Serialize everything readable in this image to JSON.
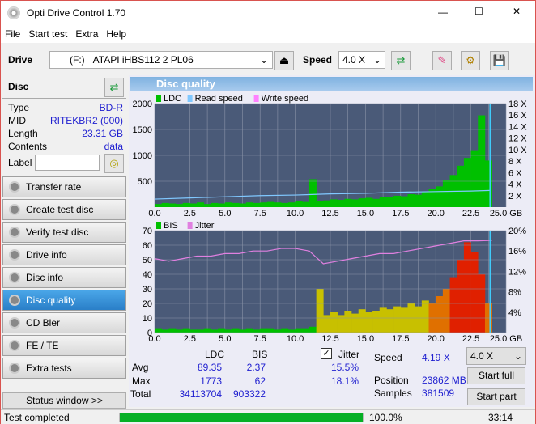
{
  "window": {
    "title": "Opti Drive Control 1.70",
    "minimize": "—",
    "maximize": "☐",
    "close": "✕"
  },
  "menu": [
    "File",
    "Start test",
    "Extra",
    "Help"
  ],
  "toolbar": {
    "drive_label": "Drive",
    "drive_letter": "(F:)",
    "drive_name": "ATAPI iHBS112  2 PL06",
    "speed_label": "Speed",
    "speed_value": "4.0 X"
  },
  "disc": {
    "title": "Disc",
    "type_label": "Type",
    "type": "BD-R",
    "mid_label": "MID",
    "mid": "RITEKBR2 (000)",
    "length_label": "Length",
    "length": "23.31 GB",
    "contents_label": "Contents",
    "contents": "data",
    "label_label": "Label",
    "label_value": ""
  },
  "sidebar": {
    "items": [
      "Transfer rate",
      "Create test disc",
      "Verify test disc",
      "Drive info",
      "Disc info",
      "Disc quality",
      "CD Bler",
      "FE / TE",
      "Extra tests"
    ],
    "selected": "Disc quality",
    "status_window": "Status window >>"
  },
  "panel_title": "Disc quality",
  "colors": {
    "ldc": "#00c000",
    "read_speed": "#80c8ff",
    "write_speed": "#ff80ff",
    "bis": "#00c000",
    "jitter": "#e080e0",
    "accent": "#2a7fc8",
    "progress": "#06b025"
  },
  "chart_data": [
    {
      "type": "bar",
      "legend": [
        "LDC",
        "Read speed",
        "Write speed"
      ],
      "x_ticks": [
        "0.0",
        "2.5",
        "5.0",
        "7.5",
        "10.0",
        "12.5",
        "15.0",
        "17.5",
        "20.0",
        "22.5",
        "25.0 GB"
      ],
      "y_ticks": [
        "500",
        "1000",
        "1500",
        "2000"
      ],
      "y2_ticks": [
        "2 X",
        "4 X",
        "6 X",
        "8 X",
        "10 X",
        "12 X",
        "14 X",
        "16 X",
        "18 X"
      ],
      "xlim": [
        0,
        25
      ],
      "ylim": [
        0,
        2000
      ],
      "y2lim": [
        0,
        18
      ],
      "x_step": 0.5,
      "ldc": [
        60,
        80,
        70,
        60,
        80,
        70,
        90,
        60,
        80,
        70,
        90,
        80,
        70,
        90,
        80,
        90,
        100,
        90,
        80,
        90,
        110,
        100,
        540,
        120,
        130,
        150,
        140,
        160,
        150,
        170,
        180,
        160,
        200,
        190,
        220,
        210,
        250,
        240,
        300,
        350,
        400,
        520,
        620,
        800,
        950,
        1100,
        1773,
        900
      ],
      "read_speed_x": [
        0,
        2.5,
        5,
        7.5,
        10,
        12.5,
        15,
        17.5,
        20,
        22.5,
        23.86
      ],
      "read_speed": [
        1.4,
        1.6,
        1.8,
        2.0,
        2.1,
        2.3,
        2.4,
        2.6,
        2.7,
        2.8,
        2.9
      ]
    },
    {
      "type": "bar",
      "legend": [
        "BIS",
        "Jitter"
      ],
      "x_ticks": [
        "0.0",
        "2.5",
        "5.0",
        "7.5",
        "10.0",
        "12.5",
        "15.0",
        "17.5",
        "20.0",
        "22.5",
        "25.0 GB"
      ],
      "y_ticks": [
        "0",
        "10",
        "20",
        "30",
        "40",
        "50",
        "60",
        "70"
      ],
      "y2_ticks": [
        "4%",
        "8%",
        "12%",
        "16%",
        "20%"
      ],
      "xlim": [
        0,
        25
      ],
      "ylim": [
        0,
        70
      ],
      "y2lim": [
        0,
        20
      ],
      "x_step": 0.5,
      "bis": [
        3,
        2,
        3,
        2,
        3,
        2,
        2,
        3,
        2,
        3,
        2,
        3,
        2,
        3,
        2,
        3,
        3,
        2,
        3,
        2,
        3,
        3,
        4,
        30,
        12,
        14,
        12,
        15,
        13,
        16,
        14,
        15,
        17,
        16,
        18,
        17,
        20,
        18,
        22,
        20,
        25,
        30,
        38,
        50,
        62,
        55,
        40,
        20
      ],
      "jitter": [
        14.5,
        14,
        14.5,
        15,
        15,
        15.5,
        15.5,
        16,
        16,
        16.5,
        16.5,
        16,
        13.5,
        14,
        14.5,
        15,
        15.5,
        15.5,
        16,
        16.5,
        17,
        17.5,
        18,
        18,
        18.1
      ]
    }
  ],
  "stats": {
    "col_ldc": "LDC",
    "col_bis": "BIS",
    "jitter_label": "Jitter",
    "jitter_checked": true,
    "avg_label": "Avg",
    "avg_ldc": "89.35",
    "avg_bis": "2.37",
    "avg_jitter": "15.5%",
    "max_label": "Max",
    "max_ldc": "1773",
    "max_bis": "62",
    "max_jitter": "18.1%",
    "total_label": "Total",
    "total_ldc": "34113704",
    "total_bis": "903322",
    "speed_label": "Speed",
    "speed": "4.19 X",
    "position_label": "Position",
    "position": "23862 MB",
    "samples_label": "Samples",
    "samples": "381509",
    "speed_select": "4.0 X",
    "start_full": "Start full",
    "start_part": "Start part"
  },
  "status": {
    "text": "Test completed",
    "progress": 100,
    "progress_text": "100.0%",
    "time": "33:14"
  }
}
